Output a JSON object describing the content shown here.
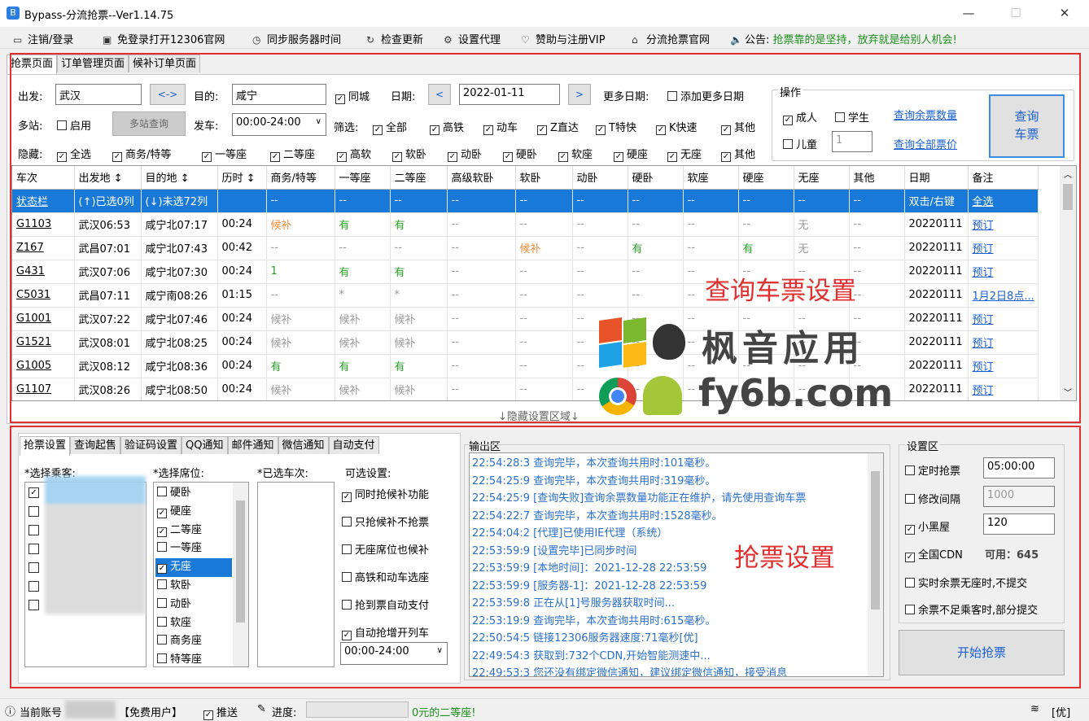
{
  "window": {
    "title": "Bypass-分流抢票--Ver1.14.75",
    "min": "—",
    "max": "☐",
    "close": "✕"
  },
  "menu": [
    {
      "icon": "▭",
      "label": "注销/登录",
      "name": "logout-login-menu"
    },
    {
      "icon": "▣",
      "label": "免登录打开12306官网",
      "name": "open-12306-menu"
    },
    {
      "icon": "◷",
      "label": "同步服务器时间",
      "name": "sync-time-menu"
    },
    {
      "icon": "↻",
      "label": "检查更新",
      "name": "check-update-menu"
    },
    {
      "icon": "⚙",
      "label": "设置代理",
      "name": "proxy-menu"
    },
    {
      "icon": "♡",
      "label": "赞助与注册VIP",
      "name": "sponsor-menu"
    },
    {
      "icon": "⌂",
      "label": "分流抢票官网",
      "name": "official-site-menu"
    }
  ],
  "notice": {
    "icon": "🔈",
    "label": "公告:",
    "text": "抢票靠的是坚持，放弃就是给别人机会!"
  },
  "mainTabs": [
    "抢票页面",
    "订单管理页面",
    "候补订单页面"
  ],
  "query": {
    "from_label": "出发:",
    "from": "武汉",
    "swap": "<->",
    "to_label": "目的:",
    "to": "咸宁",
    "samecity": "同城",
    "date_label": "日期:",
    "date": "2022-01-11",
    "prev": "<",
    "next": ">",
    "more_dates_label": "更多日期:",
    "add_more_dates": "添加更多日期",
    "multi_label": "多站:",
    "enable": "启用",
    "multi_query": "多站查询",
    "depart_label": "发车:",
    "depart_time": "00:00-24:00",
    "filter_label": "筛选:",
    "filters": [
      "全部",
      "高铁",
      "动车",
      "Z直达",
      "T特快",
      "K快速",
      "其他"
    ],
    "hide_label": "隐藏:",
    "hides": [
      "全选",
      "商务/特等",
      "一等座",
      "二等座",
      "高软",
      "软卧",
      "动卧",
      "硬卧",
      "软座",
      "硬座",
      "无座",
      "其他"
    ],
    "ops_title": "操作",
    "adult": "成人",
    "student": "学生",
    "child": "儿童",
    "child_count": "1",
    "query_remaining": "查询余票数量",
    "query_all_price": "查询全部票价",
    "query_btn_line1": "查询",
    "query_btn_line2": "车票"
  },
  "table": {
    "headers": [
      "车次",
      "出发地 ↕",
      "目的地 ↕",
      "历时 ↕",
      "商务/特等",
      "一等座",
      "二等座",
      "高级软卧",
      "软卧",
      "动卧",
      "硬卧",
      "软座",
      "硬座",
      "无座",
      "其他",
      "日期",
      "备注"
    ],
    "rows": [
      [
        "状态栏",
        "(↑)已选0列",
        "(↓)未选72列",
        "",
        "--",
        "--",
        "--",
        "--",
        "--",
        "--",
        "--",
        "--",
        "--",
        "--",
        "--",
        "双击/右键",
        "全选"
      ],
      [
        "G1103",
        "武汉06:53",
        "咸宁北07:17",
        "00:24",
        "候补",
        "有",
        "有",
        "--",
        "--",
        "--",
        "--",
        "--",
        "--",
        "无",
        "--",
        "20220111",
        "预订"
      ],
      [
        "Z167",
        "武昌07:01",
        "咸宁北07:43",
        "00:42",
        "--",
        "--",
        "--",
        "--",
        "候补",
        "--",
        "有",
        "--",
        "有",
        "无",
        "--",
        "20220111",
        "预订"
      ],
      [
        "G431",
        "武汉07:06",
        "咸宁北07:30",
        "00:24",
        "1",
        "有",
        "有",
        "--",
        "--",
        "--",
        "--",
        "--",
        "--",
        "--",
        "--",
        "20220111",
        "预订"
      ],
      [
        "C5031",
        "武昌07:11",
        "咸宁南08:26",
        "01:15",
        "--",
        "*",
        "*",
        "--",
        "--",
        "--",
        "--",
        "--",
        "--",
        "--",
        "--",
        "20220111",
        "1月2日8点..."
      ],
      [
        "G1001",
        "武汉07:22",
        "咸宁北07:46",
        "00:24",
        "候补",
        "候补",
        "候补",
        "--",
        "--",
        "--",
        "--",
        "--",
        "--",
        "--",
        "--",
        "20220111",
        "预订"
      ],
      [
        "G1521",
        "武汉08:01",
        "咸宁北08:25",
        "00:24",
        "候补",
        "候补",
        "候补",
        "--",
        "--",
        "--",
        "--",
        "--",
        "--",
        "--",
        "--",
        "20220111",
        "预订"
      ],
      [
        "G1005",
        "武汉08:12",
        "咸宁北08:36",
        "00:24",
        "有",
        "有",
        "有",
        "--",
        "--",
        "--",
        "--",
        "--",
        "--",
        "--",
        "--",
        "20220111",
        "预订"
      ],
      [
        "G1107",
        "武汉08:26",
        "咸宁北08:50",
        "00:24",
        "候补",
        "候补",
        "候补",
        "--",
        "--",
        "--",
        "--",
        "--",
        "--",
        "--",
        "--",
        "20220111",
        "预订"
      ]
    ]
  },
  "annot": {
    "query_settings": "查询车票设置",
    "grab_settings": "抢票设置",
    "watermark1": "枫音应用",
    "watermark2": "fy6b.com"
  },
  "hide_area": "↓隐藏设置区域↓",
  "subTabs": [
    "抢票设置",
    "查询起售",
    "验证码设置",
    "QQ通知",
    "邮件通知",
    "微信通知",
    "自动支付"
  ],
  "grab": {
    "select_passenger": "*选择乘客:",
    "select_seat": "*选择席位:",
    "selected_trains": "*已选车次:",
    "optional": "可选设置:",
    "seats": [
      {
        "label": "硬卧",
        "checked": false
      },
      {
        "label": "硬座",
        "checked": true
      },
      {
        "label": "二等座",
        "checked": true
      },
      {
        "label": "一等座",
        "checked": false
      },
      {
        "label": "无座",
        "checked": true
      },
      {
        "label": "软卧",
        "checked": false
      },
      {
        "label": "动卧",
        "checked": false
      },
      {
        "label": "软座",
        "checked": false
      },
      {
        "label": "商务座",
        "checked": false
      },
      {
        "label": "特等座",
        "checked": false
      }
    ],
    "options": [
      {
        "label": "同时抢候补功能",
        "checked": true
      },
      {
        "label": "只抢候补不抢票",
        "checked": false
      },
      {
        "label": "无座席位也候补",
        "checked": false
      },
      {
        "label": "高铁和动车选座",
        "checked": false
      },
      {
        "label": "抢到票自动支付",
        "checked": false
      },
      {
        "label": "自动抢增开列车",
        "checked": true
      }
    ],
    "time_range": "00:00-24:00"
  },
  "output": {
    "title": "输出区",
    "lines": [
      "22:54:28:3  查询完毕，本次查询共用时:101毫秒。",
      "22:54:25:9  查询完毕，本次查询共用时:319毫秒。",
      "22:54:25:9  [查询失败]查询余票数量功能正在维护，请先使用查询车票",
      "22:54:22:7  查询完毕，本次查询共用时:1528毫秒。",
      "22:54:04:2  [代理]已使用IE代理（系统）",
      "22:53:59:9  [设置完毕]已同步时间",
      "22:53:59:9  [本地时间]：2021-12-28 22:53:59",
      "22:53:59:9  [服务器-1]：2021-12-28 22:53:59",
      "22:53:59:8  正在从[1]号服务器获取时间...",
      "22:53:19:9  查询完毕，本次查询共用时:615毫秒。",
      "22:50:54:5  链接12306服务器速度:71毫秒[优]",
      "22:49:54:3  获取到:732个CDN,开始智能测速中...",
      "22:49:53:3  您还没有绑定微信通知，建议绑定微信通知，接受消息"
    ]
  },
  "settings": {
    "title": "设置区",
    "timed": "定时抢票",
    "timed_value": "05:00:00",
    "interval": "修改间隔",
    "interval_value": "1000",
    "blackroom": "小黑屋",
    "blackroom_value": "120",
    "cdn": "全国CDN",
    "cdn_avail": "可用：645",
    "realtime": "实时余票无座时,不提交",
    "partial": "余票不足乘客时,部分提交",
    "start": "开始抢票"
  },
  "status": {
    "account": "当前账号",
    "user_type": "【免费用户】",
    "push": "推送",
    "progress": "进度:",
    "seat_info": "0元的二等座!",
    "signal": "[优]"
  }
}
